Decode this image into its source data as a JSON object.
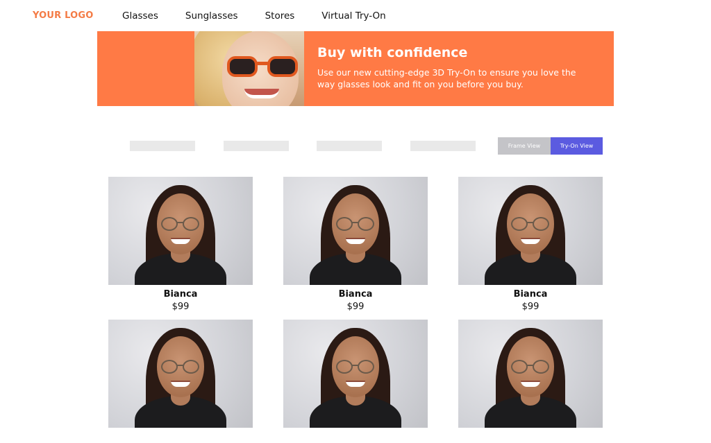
{
  "header": {
    "logo": "YOUR LOGO",
    "nav": [
      "Glasses",
      "Sunglasses",
      "Stores",
      "Virtual Try-On"
    ]
  },
  "banner": {
    "title": "Buy with confidence",
    "text": "Use our new cutting-edge 3D Try-On to ensure you love the way glasses look and fit on you before you buy."
  },
  "view_toggle": {
    "frame_label": "Frame View",
    "tryon_label": "Try-On View",
    "selected": "Try-On View"
  },
  "products": [
    {
      "name": "Bianca",
      "price": "$99"
    },
    {
      "name": "Bianca",
      "price": "$99"
    },
    {
      "name": "Bianca",
      "price": "$99"
    },
    {
      "name": "",
      "price": ""
    },
    {
      "name": "",
      "price": ""
    },
    {
      "name": "",
      "price": ""
    }
  ],
  "colors": {
    "brand_orange": "#ff7a45",
    "logo_orange": "#f47b45",
    "toggle_active": "#5b5be0",
    "toggle_inactive": "#c4c4c8"
  }
}
